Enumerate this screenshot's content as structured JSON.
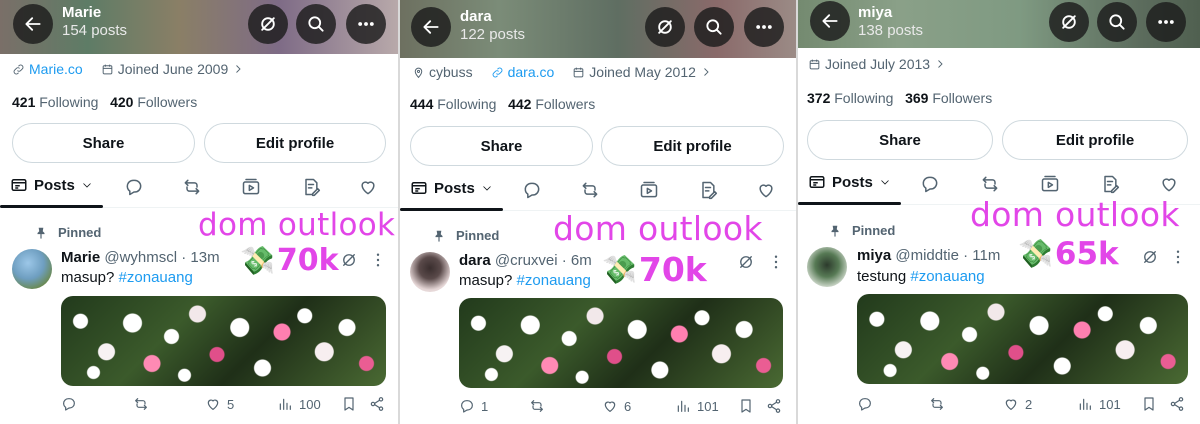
{
  "profiles": [
    {
      "name": "Marie",
      "posts_count": "154 posts",
      "location": "",
      "website": "Marie.co",
      "joined": "Joined June 2009",
      "following_count": "421",
      "following_label": "Following",
      "followers_count": "420",
      "followers_label": "Followers",
      "share_label": "Share",
      "edit_label": "Edit profile",
      "tab_label": "Posts",
      "pinned_label": "Pinned",
      "post_name": "Marie",
      "post_handle_time": "@wyhmscl · 13m",
      "post_text": "masup? ",
      "post_tag": "#zonauang",
      "reply_count": "",
      "repost_count": "",
      "like_count": "5",
      "view_count": "100",
      "overlay_title": "dom outlook",
      "overlay_value": "70k"
    },
    {
      "name": "dara",
      "posts_count": "122 posts",
      "location": "cybuss",
      "website": "dara.co",
      "joined": "Joined May 2012",
      "following_count": "444",
      "following_label": "Following",
      "followers_count": "442",
      "followers_label": "Followers",
      "share_label": "Share",
      "edit_label": "Edit profile",
      "tab_label": "Posts",
      "pinned_label": "Pinned",
      "post_name": "dara",
      "post_handle_time": "@cruxvei · 6m",
      "post_text": "masup? ",
      "post_tag": "#zonauang",
      "reply_count": "1",
      "repost_count": "",
      "like_count": "6",
      "view_count": "101",
      "overlay_title": "dom outlook",
      "overlay_value": "70k"
    },
    {
      "name": "miya",
      "posts_count": "138 posts",
      "location": "",
      "website": "",
      "joined": "Joined July 2013",
      "following_count": "372",
      "following_label": "Following",
      "followers_count": "369",
      "followers_label": "Followers",
      "share_label": "Share",
      "edit_label": "Edit profile",
      "tab_label": "Posts",
      "pinned_label": "Pinned",
      "post_name": "miya",
      "post_handle_time": "@middtie · 11m",
      "post_text": "testung ",
      "post_tag": "#zonauang",
      "reply_count": "",
      "repost_count": "",
      "like_count": "2",
      "view_count": "101",
      "overlay_title": "dom outlook",
      "overlay_value": "65k"
    }
  ],
  "colors": {
    "link": "#1d9bf0",
    "muted": "#536471",
    "text": "#0f1419",
    "overlay": "#e246e8"
  },
  "icons": {
    "back": "arrow-left-icon",
    "grok": "grok-icon",
    "search": "search-icon",
    "more": "more-horizontal-icon",
    "money": "money-with-wings-icon"
  }
}
